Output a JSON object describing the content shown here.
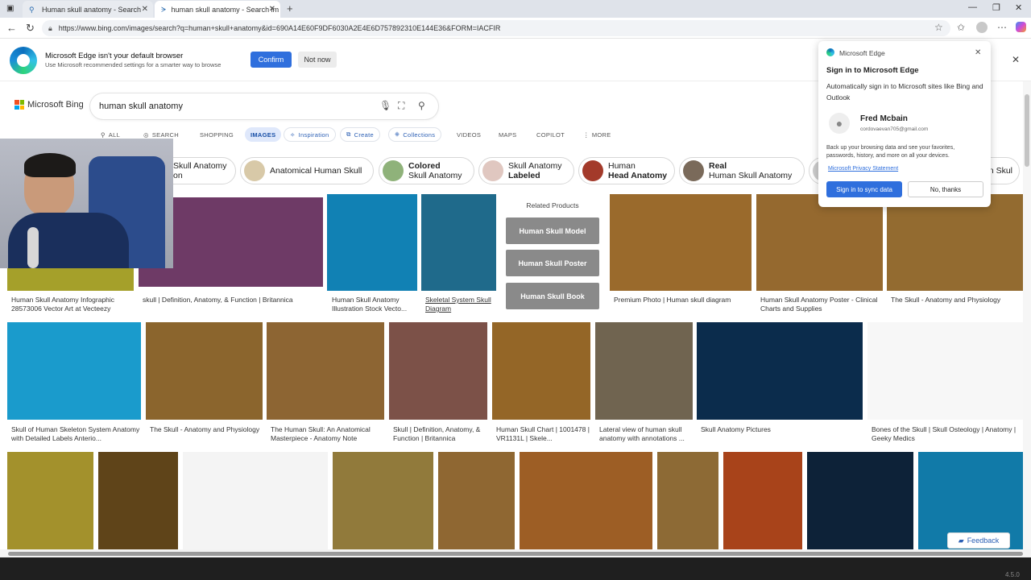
{
  "browser": {
    "tabs": [
      {
        "label": "Human skull anatomy - Search"
      },
      {
        "label": "human skull anatomy - Search im"
      }
    ],
    "url": "https://www.bing.com/images/search?q=human+skull+anatomy&id=690A14E60F9DF6030A2E4E6D757892310E144E36&FORM=IACFIR"
  },
  "infobar": {
    "title": "Microsoft Edge isn't your default browser",
    "subtitle": "Use Microsoft recommended settings for a smarter way to browse",
    "confirm_label": "Confirm",
    "notnow_label": "Not now"
  },
  "bing": {
    "logo_text": "Microsoft Bing",
    "query": "human skull anatomy",
    "scopes": [
      "ALL",
      "SEARCH",
      "SHOPPING",
      "IMAGES",
      "Inspiration",
      "Create",
      "Collections",
      "VIDEOS",
      "MAPS",
      "COPILOT",
      "MORE"
    ]
  },
  "chips": [
    {
      "line1": "Skull Anatomy",
      "line2": "on",
      "color": "#c9a98a"
    },
    {
      "line1": "Anatomical Human Skull",
      "line2": "",
      "color": "#d8c9a8"
    },
    {
      "line1": "Colored",
      "line2": "Skull Anatomy",
      "color": "#8fb27a"
    },
    {
      "line1": "Skull Anatomy",
      "line2": "Labeled",
      "color": "#e0c7c0"
    },
    {
      "line1": "Human",
      "line2": "Head Anatomy",
      "color": "#a33a2a"
    },
    {
      "line1": "Real",
      "line2": "Human Skull Anatomy",
      "color": "#7a6a5a"
    },
    {
      "line1": "n Skul",
      "line2": "",
      "color": "#ccc"
    }
  ],
  "related": {
    "title": "Related Products",
    "items": [
      "Human Skull Model",
      "Human Skull Poster",
      "Human Skull Book"
    ]
  },
  "grid": {
    "row1": [
      {
        "caption": "Human Skull Anatomy Infographic 28573006 Vector Art at Vecteezy",
        "color": "#a5a02a"
      },
      {
        "caption": "skull | Definition, Anatomy, & Function | Britannica",
        "color": "#6e3a66"
      },
      {
        "caption": "Human Skull Anatomy Illustration Stock Vecto...",
        "color": "#1181b4"
      },
      {
        "caption": "Skeletal System Skull Diagram",
        "color": "#1f6a8b"
      },
      {
        "caption": "Premium Photo | Human skull diagram",
        "color": "#9a6a2c"
      },
      {
        "caption": "Human Skull Anatomy Poster - Clinical Charts and Supplies",
        "color": "#95692f"
      },
      {
        "caption": "The Skull - Anatomy and Physiology",
        "color": "#936b30"
      }
    ],
    "row2": [
      {
        "caption": "Skull of Human Skeleton System Anatomy with Detailed Labels Anterio...",
        "color": "#1a9bcc"
      },
      {
        "caption": "The Skull - Anatomy and Physiology",
        "color": "#8b652d"
      },
      {
        "caption": "The Human Skull: An Anatomical Masterpiece - Anatomy Note",
        "color": "#8d6533"
      },
      {
        "caption": "Skull | Definition, Anatomy, & Function | Britannica",
        "color": "#7c5148"
      },
      {
        "caption": "Human Skull Chart | 1001478 | VR1131L | Skele...",
        "color": "#946627"
      },
      {
        "caption": "Lateral view of human skull anatomy with annotations ...",
        "color": "#706450"
      },
      {
        "caption": "Skull Anatomy Pictures",
        "color": "#0b2c4c"
      },
      {
        "caption": "Bones of the Skull | Skull Osteology | Anatomy | Geeky Medics",
        "color": "#f7f7f7"
      }
    ],
    "row3": [
      {
        "color": "#a3912c"
      },
      {
        "color": "#5f4419"
      },
      {
        "color": "#f4f4f4"
      },
      {
        "color": "#917a3b"
      },
      {
        "color": "#8f6732"
      },
      {
        "color": "#9d5e25"
      },
      {
        "color": "#8d6a35"
      },
      {
        "color": "#a8431a"
      },
      {
        "color": "#0d2238"
      },
      {
        "color": "#117aa8"
      }
    ]
  },
  "signin": {
    "app": "Microsoft Edge",
    "title": "Sign in to Microsoft Edge",
    "desc": "Automatically sign in to Microsoft sites like Bing and Outlook",
    "user_name": "Fred Mcbain",
    "user_email": "cordovaevan705@gmail.com",
    "backup_text": "Back up your browsing data and see your favorites, passwords, history, and more on all your devices.",
    "privacy_link": "Microsoft Privacy Statement",
    "sync_label": "Sign in to sync data",
    "decline_label": "No, thanks"
  },
  "feedback_label": "Feedback",
  "version": "4.5.0"
}
